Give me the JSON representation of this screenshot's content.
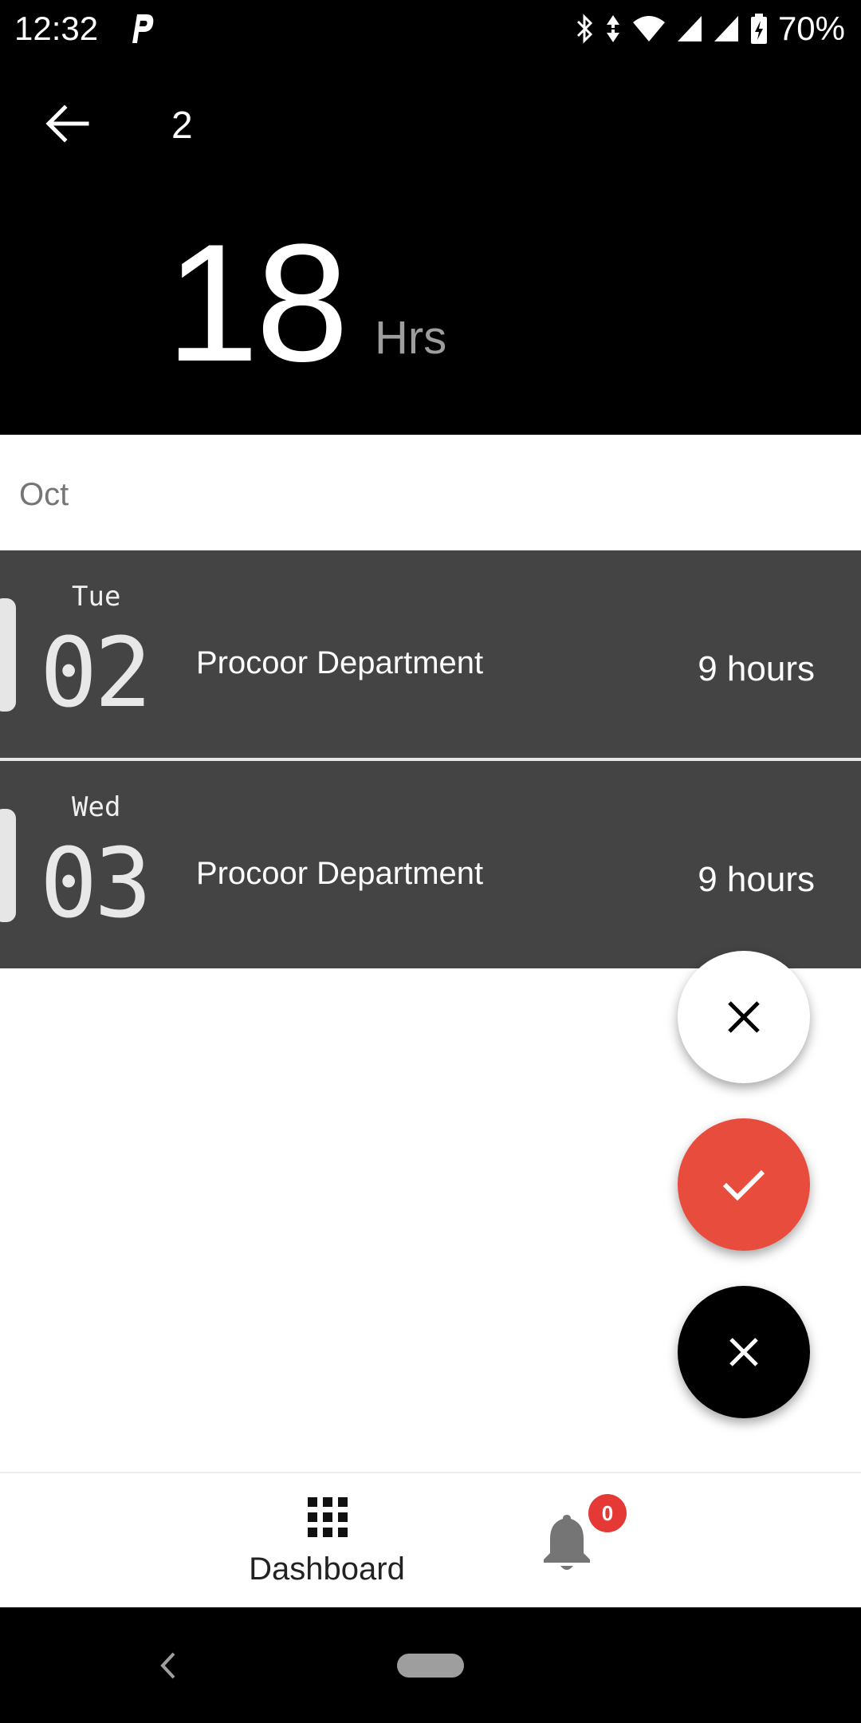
{
  "status_bar": {
    "time": "12:32",
    "battery_percent": "70%",
    "icons": [
      "parking-app-icon",
      "bluetooth-icon",
      "data-arrows-icon",
      "wifi-icon",
      "signal-icon",
      "signal-icon",
      "battery-charging-icon"
    ]
  },
  "header": {
    "back_icon": "arrow-left-icon",
    "selected_count": "2",
    "total_value": "18",
    "total_unit": "Hrs"
  },
  "month": "Oct",
  "entries": [
    {
      "weekday": "Tue",
      "day": "02",
      "department": "Procoor Department",
      "hours": "9 hours"
    },
    {
      "weekday": "Wed",
      "day": "03",
      "department": "Procoor Department",
      "hours": "9 hours"
    }
  ],
  "fabs": {
    "reject_icon": "close-icon",
    "approve_icon": "check-icon",
    "main_icon": "close-icon"
  },
  "bottom_nav": {
    "dashboard_label": "Dashboard",
    "dashboard_icon": "grid-icon",
    "notifications_icon": "bell-icon",
    "notifications_count": "0"
  },
  "colors": {
    "header_bg": "#000000",
    "row_bg": "#444444",
    "approve": "#e84c3d",
    "badge": "#e53935"
  }
}
